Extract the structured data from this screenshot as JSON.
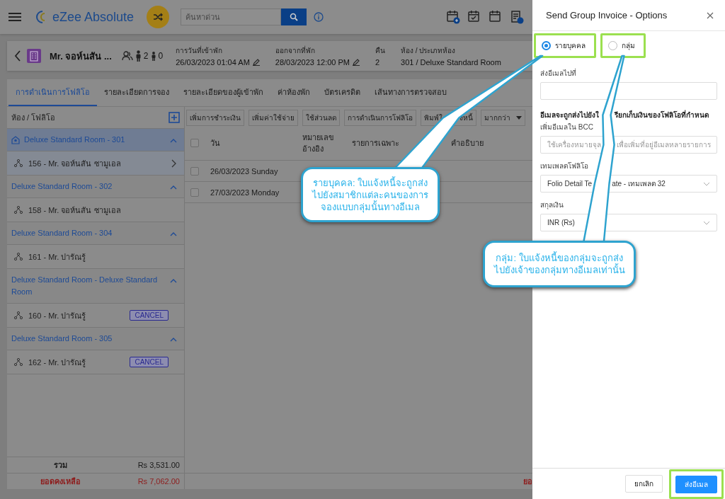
{
  "header": {
    "app_name": "eZee Absolute",
    "search": {
      "placeholder": "ค้นหาด่วน"
    }
  },
  "guest": {
    "name": "Mr. จอห์นสัน ...",
    "adults": "2",
    "children": "0",
    "fields": [
      {
        "label": "การวันที่เข้าพัก",
        "value": "26/03/2023 01:04 AM",
        "editable": true
      },
      {
        "label": "ออกจากที่พัก",
        "value": "28/03/2023 12:00 PM",
        "editable": true
      },
      {
        "label": "คืน",
        "value": "2",
        "editable": false
      },
      {
        "label": "ห้อง / ประเภทห้อง",
        "value": "301 / Deluxe Standard Room",
        "editable": false
      }
    ]
  },
  "tabs": [
    {
      "label": "การดำเนินการโฟลิโอ",
      "selected": true
    },
    {
      "label": "รายละเอียดการจอง",
      "selected": false
    },
    {
      "label": "รายละเอียดของผู้เข้าพัก",
      "selected": false
    },
    {
      "label": "ค่าห้องพัก",
      "selected": false
    },
    {
      "label": "บัตรเครดิต",
      "selected": false
    },
    {
      "label": "เส้นทางการตรวจสอบ",
      "selected": false
    }
  ],
  "sidebar": {
    "title": "ห้อง / โฟลิโอ",
    "groups": [
      {
        "room": "Deluxe Standard Room - 301",
        "main": true,
        "selected": true,
        "expanded": true,
        "folios": [
          {
            "label": "156 - Mr. จอห์นสัน ซามูเอล",
            "selected": true
          }
        ]
      },
      {
        "room": "Deluxe Standard Room - 302",
        "main": false,
        "selected": false,
        "expanded": true,
        "folios": [
          {
            "label": "158 - Mr. จอห์นสัน ซามูเอล",
            "selected": false
          }
        ]
      },
      {
        "room": "Deluxe Standard Room - 304",
        "main": false,
        "selected": false,
        "expanded": true,
        "folios": [
          {
            "label": "161 - Mr. ปารัณรู้",
            "selected": false
          }
        ]
      },
      {
        "room": "Deluxe Standard Room - Deluxe Standard Room",
        "main": false,
        "selected": false,
        "expanded": true,
        "folios": [
          {
            "label": "160 - Mr. ปารัณรู้",
            "selected": false,
            "badge": "CANCEL"
          }
        ]
      },
      {
        "room": "Deluxe Standard Room - 305",
        "main": false,
        "selected": false,
        "expanded": true,
        "folios": [
          {
            "label": "162 - Mr. ปารัณรู้",
            "selected": false,
            "badge": "CANCEL"
          }
        ]
      }
    ],
    "totals": [
      {
        "label": "รวม",
        "value": "Rs 3,531.00",
        "kind": "total"
      },
      {
        "label": "ยอดคงเหลือ",
        "value": "Rs 7,062.00",
        "kind": "balance"
      }
    ]
  },
  "toolbar": [
    {
      "label_parts": [
        "เพิ่มการชำระเงิน"
      ],
      "kind": "button"
    },
    {
      "label_parts": [
        "เพิ่มค่าใช้จ่าย"
      ],
      "kind": "button"
    },
    {
      "label_parts": [
        "ใช้ส่วนลด"
      ],
      "kind": "button"
    },
    {
      "label_parts": [
        "การดำเนินการโฟลิโอ"
      ],
      "kind": "button"
    },
    {
      "label_parts": [
        "พิมพ์ใ",
        "งหนี้"
      ],
      "kind": "button"
    },
    {
      "label_parts": [
        "มากกว่า"
      ],
      "kind": "menu"
    }
  ],
  "table": {
    "select_all_checked": false,
    "columns": [
      "วัน",
      "หมายเลข อ้างอิง",
      "รายการเฉพาะ",
      "คำอธิบาย"
    ],
    "rows": [
      {
        "date": "26/03/2023 Sunday",
        "checked": false
      },
      {
        "date": "27/03/2023 Monday",
        "checked": false
      }
    ],
    "footer_label": "ยอ"
  },
  "drawer": {
    "title": "Send Group Invoice - Options",
    "modes": [
      {
        "label": "รายบุคคล",
        "selected": true,
        "highlighted": true
      },
      {
        "label": "กลุ่ม",
        "selected": false,
        "highlighted": true
      }
    ],
    "fields": [
      {
        "kind": "input",
        "label": "ส่งอีเมลไปที่"
      },
      {
        "kind": "note",
        "label_parts": [
          "อีเมลจะถูกส่งไปยังใ",
          "รียกเก็บเงินของโฟลิโอที่กำหนด"
        ]
      },
      {
        "kind": "input",
        "label": "เพิ่มอีเมลใน BCC",
        "placeholder_parts": [
          "ใช้เครื่องหมายจุล",
          "เพื่อเพิ่มที่อยู่อีเมลหลายรายการ"
        ]
      },
      {
        "kind": "select",
        "label": "เทมเพลตโฟลิโอ",
        "value_parts": [
          "Folio Detail Te",
          "ate - เทมเพลต 32"
        ]
      },
      {
        "kind": "select",
        "label": "สกุลเงิน",
        "value_parts": [
          "INR (Rs)"
        ]
      }
    ],
    "buttons": [
      {
        "label": "ยกเลิก",
        "kind": "secondary",
        "highlighted": false
      },
      {
        "label": "ส่งอีเมล",
        "kind": "primary",
        "highlighted": true
      }
    ]
  },
  "callouts": [
    {
      "text": "รายบุคคล: ใบแจ้งหนี้จะถูกส่งไปยังสมาชิกแต่ละคนของการจองแบบกลุ่มนั้นทางอีเมล"
    },
    {
      "text": "กลุ่ม: ใบแจ้งหนี้ของกลุ่มจะถูกส่งไปยังเจ้าของกลุ่มทางอีเมลเท่านั้น"
    }
  ]
}
